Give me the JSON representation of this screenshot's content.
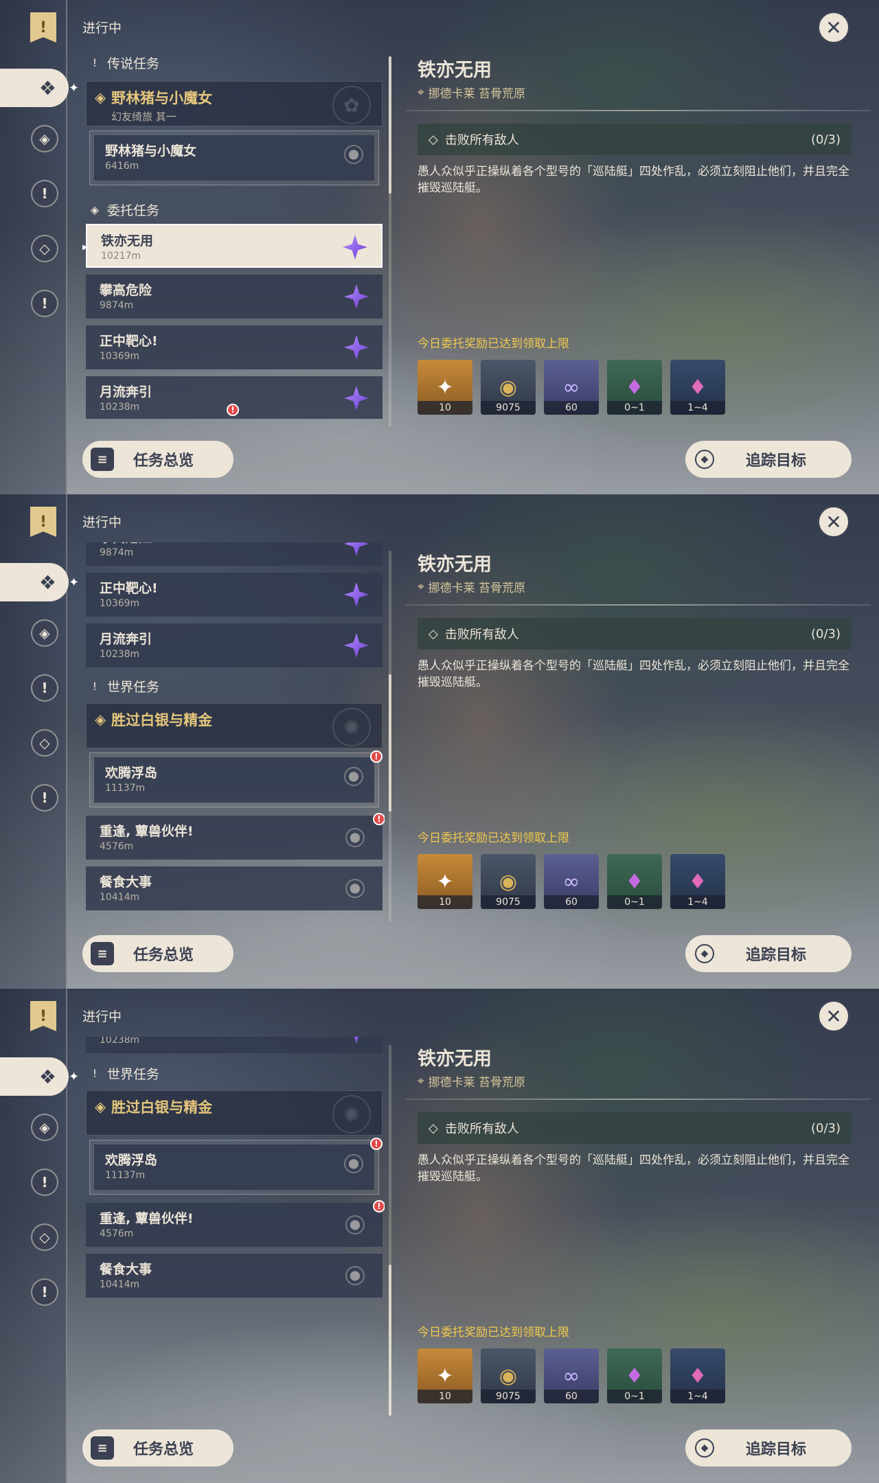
{
  "status_label": "进行中",
  "detail": {
    "title": "铁亦无用",
    "location": "挪德卡莱 苔骨荒原",
    "objective": "击败所有敌人",
    "objective_progress": "(0/3)",
    "description": "愚人众似乎正操纵着各个型号的「巡陆艇」四处作乱，必须立刻阻止他们，并且完全摧毁巡陆艇。",
    "reward_note": "今日委托奖励已达到领取上限",
    "rewards": [
      {
        "icon": "primogem-icon",
        "count": "10",
        "color": "#b07a2c"
      },
      {
        "icon": "mora-icon",
        "count": "9075",
        "color": "#3e4a5c"
      },
      {
        "icon": "friendship-exp-icon",
        "count": "60",
        "color": "#4a4f78"
      },
      {
        "icon": "crystal-icon",
        "count": "0~1",
        "color": "#3b5a4a"
      },
      {
        "icon": "crystal-cluster-icon",
        "count": "1~4",
        "color": "#2c3b55"
      }
    ]
  },
  "buttons": {
    "overview": "任务总览",
    "track": "追踪目标"
  },
  "categories": {
    "legend": "传说任务",
    "commission": "委托任务",
    "world": "世界任务"
  },
  "legend_group": {
    "title": "野林猪与小魔女",
    "subtitle": "幻友绮旅 其一",
    "sub": {
      "title": "野林猪与小魔女",
      "distance": "6416m"
    }
  },
  "commissions": [
    {
      "title": "铁亦无用",
      "distance": "10217m"
    },
    {
      "title": "攀高危险",
      "distance": "9874m"
    },
    {
      "title": "正中靶心!",
      "distance": "10369m"
    },
    {
      "title": "月流奔引",
      "distance": "10238m"
    }
  ],
  "world_group": {
    "title": "胜过白银与精金",
    "sub": {
      "title": "欢腾浮岛",
      "distance": "11137m"
    }
  },
  "world_quests": [
    {
      "title": "重逢, 蕈兽伙伴!",
      "distance": "4576m"
    },
    {
      "title": "餐食大事",
      "distance": "10414m"
    }
  ],
  "colors": {
    "accent_gold": "#e5c67c",
    "reward_note": "#f2c94c",
    "panel_light": "#ece5d8",
    "panel_dark": "#3b4152"
  }
}
